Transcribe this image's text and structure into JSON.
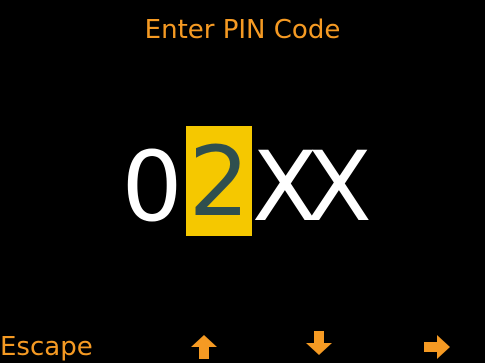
{
  "screen": {
    "title": "Enter PIN Code"
  },
  "pin": {
    "digits": [
      "0",
      "2",
      "X",
      "X"
    ],
    "active_index": 1
  },
  "softkeys": {
    "escape_label": "Escape",
    "up_icon": "arrow-up-icon",
    "down_icon": "arrow-down-icon",
    "right_icon": "arrow-right-icon"
  },
  "colors": {
    "background": "#000000",
    "accent": "#f59a23",
    "highlight": "#f5c800",
    "highlight_text": "#2f4f4f",
    "digit_text": "#ffffff"
  }
}
